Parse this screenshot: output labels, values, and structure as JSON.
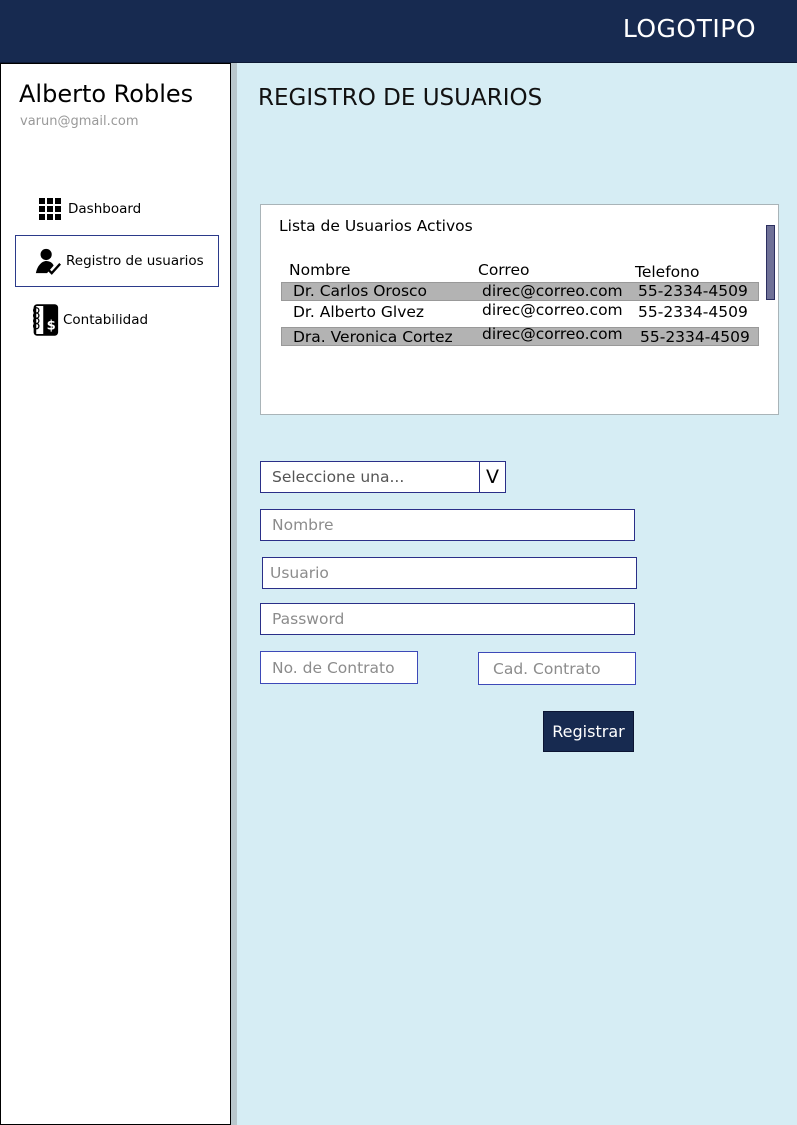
{
  "header": {
    "logo": "LOGOTIPO"
  },
  "user": {
    "name": "Alberto Robles",
    "email": "varun@gmail.com"
  },
  "sidebar": {
    "items": [
      {
        "label": "Dashboard",
        "icon": "grid-icon"
      },
      {
        "label": "Registro de usuarios",
        "icon": "user-check-icon",
        "active": true
      },
      {
        "label": "Contabilidad",
        "icon": "ledger-dollar-icon"
      }
    ]
  },
  "main": {
    "title": "REGISTRO DE USUARIOS",
    "panel": {
      "title": "Lista de Usuarios Activos",
      "columns": [
        "Nombre",
        "Correo",
        "Telefono"
      ],
      "rows": [
        {
          "nombre": "Dr. Carlos Orosco",
          "correo": "direc@correo.com",
          "telefono": "55-2334-4509"
        },
        {
          "nombre": "Dr. Alberto Glvez",
          "correo": "direc@correo.com",
          "telefono": "55-2334-4509"
        },
        {
          "nombre": "Dra. Veronica Cortez",
          "correo": "direc@correo.com",
          "telefono": "55-2334-4509"
        }
      ]
    },
    "form": {
      "select_value": "Seleccione una...",
      "select_button": "V",
      "nombre_placeholder": "Nombre",
      "usuario_placeholder": "Usuario",
      "password_placeholder": "Password",
      "contrato_placeholder": "No. de Contrato",
      "cad_contrato_placeholder": "Cad. Contrato",
      "submit_label": "Registrar"
    }
  },
  "colors": {
    "header": "#172a50",
    "main_bg": "#d6edf4",
    "accent_border": "#2a2f88",
    "row_shade": "#b3b3b3"
  }
}
